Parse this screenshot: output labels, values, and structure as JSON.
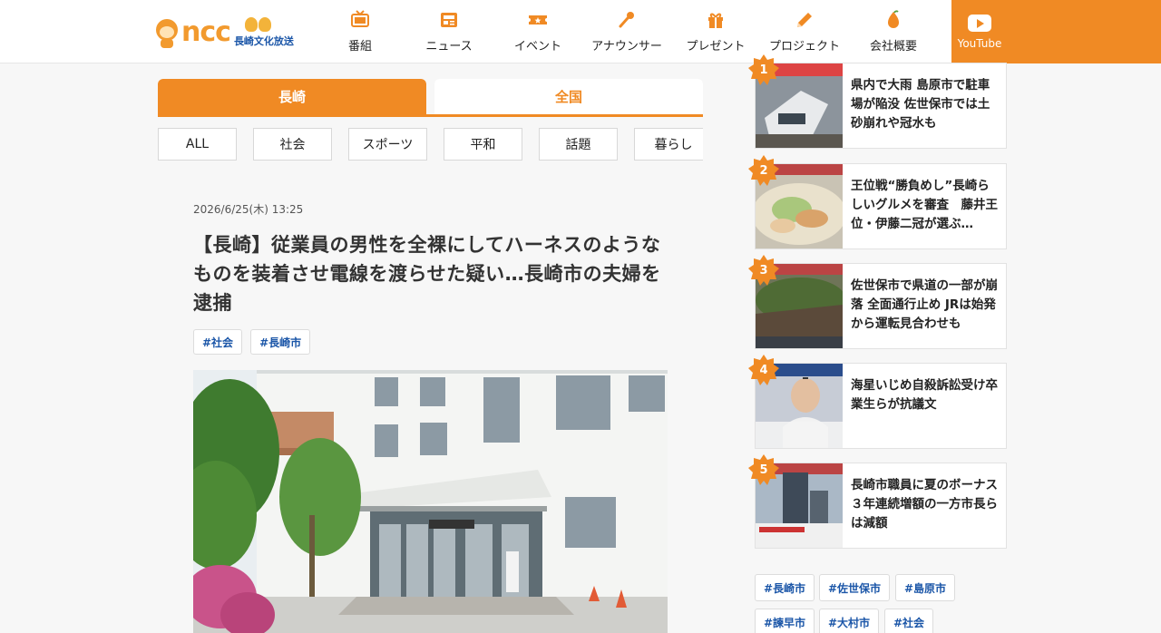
{
  "brand": {
    "name": "ncc",
    "sub": "長崎文化放送",
    "accent": "#f08a24",
    "link_color": "#1b56a8"
  },
  "nav": [
    {
      "label": "番組",
      "icon": "tv-icon"
    },
    {
      "label": "ニュース",
      "icon": "news-icon"
    },
    {
      "label": "イベント",
      "icon": "ticket-icon"
    },
    {
      "label": "アナウンサー",
      "icon": "microphone-icon"
    },
    {
      "label": "プレゼント",
      "icon": "gift-icon"
    },
    {
      "label": "プロジェクト",
      "icon": "pencil-icon"
    },
    {
      "label": "会社概要",
      "icon": "building-icon"
    }
  ],
  "youtube_label": "YouTube",
  "region_tabs": [
    "長崎",
    "全国"
  ],
  "categories": [
    "ALL",
    "社会",
    "スポーツ",
    "平和",
    "話題",
    "暮らし"
  ],
  "article": {
    "date": "2026/6/25(木) 13:25",
    "title": "【長崎】従業員の男性を全裸にしてハーネスのようなものを装着させ電線を渡らせた疑い…長崎市の夫婦を逮捕",
    "tags": [
      "#社会",
      "#長崎市"
    ]
  },
  "ranking": [
    {
      "rank": "1",
      "title": "県内で大雨 島原市で駐車場が陥没 佐世保市では土砂崩れや冠水も"
    },
    {
      "rank": "2",
      "title": "王位戦“勝負めし”長崎らしいグルメを審査　藤井王位・伊藤二冠が選ぶ…"
    },
    {
      "rank": "3",
      "title": "佐世保市で県道の一部が崩落 全面通行止め JRは始発から運転見合わせも"
    },
    {
      "rank": "4",
      "title": "海星いじめ自殺訴訟受け卒業生らが抗議文"
    },
    {
      "rank": "5",
      "title": "長崎市職員に夏のボーナス　３年連続増額の一方市長らは減額"
    }
  ],
  "side_tags": [
    "#長崎市",
    "#佐世保市",
    "#島原市",
    "#諫早市",
    "#大村市",
    "#社会"
  ]
}
